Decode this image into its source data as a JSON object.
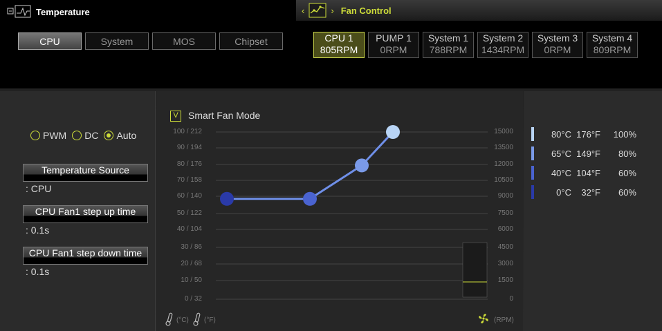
{
  "header": {
    "temperature_title": "Temperature",
    "fan_control_title": "Fan Control",
    "prev_arrow": "‹",
    "next_arrow": "›"
  },
  "temp_tabs": [
    {
      "label": "CPU",
      "active": true
    },
    {
      "label": "System",
      "active": false
    },
    {
      "label": "MOS",
      "active": false
    },
    {
      "label": "Chipset",
      "active": false
    }
  ],
  "fans": [
    {
      "name": "CPU 1",
      "rpm": "805RPM",
      "active": true
    },
    {
      "name": "PUMP 1",
      "rpm": "0RPM",
      "active": false
    },
    {
      "name": "System 1",
      "rpm": "788RPM",
      "active": false
    },
    {
      "name": "System 2",
      "rpm": "1434RPM",
      "active": false
    },
    {
      "name": "System 3",
      "rpm": "0RPM",
      "active": false
    },
    {
      "name": "System 4",
      "rpm": "809RPM",
      "active": false
    }
  ],
  "mode": {
    "pwm": "PWM",
    "dc": "DC",
    "auto": "Auto",
    "selected": "Auto"
  },
  "settings": {
    "temp_source_label": "Temperature Source",
    "temp_source_value": ": CPU",
    "step_up_label": "CPU Fan1 step up time",
    "step_up_value": ": 0.1s",
    "step_down_label": "CPU Fan1 step down time",
    "step_down_value": ": 0.1s"
  },
  "smart_fan": {
    "label": "Smart Fan Mode",
    "checked": true,
    "check_glyph": "V"
  },
  "units": {
    "celsius": "(°C)",
    "fahrenheit": "(°F)",
    "rpm": "(RPM)"
  },
  "legend": [
    {
      "c": "80°C",
      "f": "176°F",
      "pct": "100%",
      "color": "#b8d4f5"
    },
    {
      "c": "65°C",
      "f": "149°F",
      "pct": "80%",
      "color": "#7a9ae8"
    },
    {
      "c": "40°C",
      "f": "104°F",
      "pct": "60%",
      "color": "#4a63d0"
    },
    {
      "c": "0°C",
      "f": "32°F",
      "pct": "60%",
      "color": "#2a3aa8"
    }
  ],
  "colors": {
    "accent": "#cddc39",
    "curve": "#6f8fe8"
  },
  "chart_data": {
    "type": "line",
    "y_left_ticks": [
      "100 / 212",
      "90 / 194",
      "80 / 176",
      "70 / 158",
      "60 / 140",
      "50 / 122",
      "40 / 104",
      "30 / 86",
      "20 / 68",
      "10 / 50",
      "0 / 32"
    ],
    "y_right_ticks": [
      "15000",
      "13500",
      "12000",
      "10500",
      "9000",
      "7500",
      "6000",
      "4500",
      "3000",
      "1500",
      "0"
    ],
    "x": [
      0,
      40,
      65,
      80
    ],
    "y": [
      60,
      60,
      80,
      100
    ],
    "xlim": [
      0,
      100
    ],
    "ylim": [
      0,
      100
    ],
    "xlabel": "",
    "ylabel": "",
    "grid": true,
    "current_rpm_level": 805
  }
}
